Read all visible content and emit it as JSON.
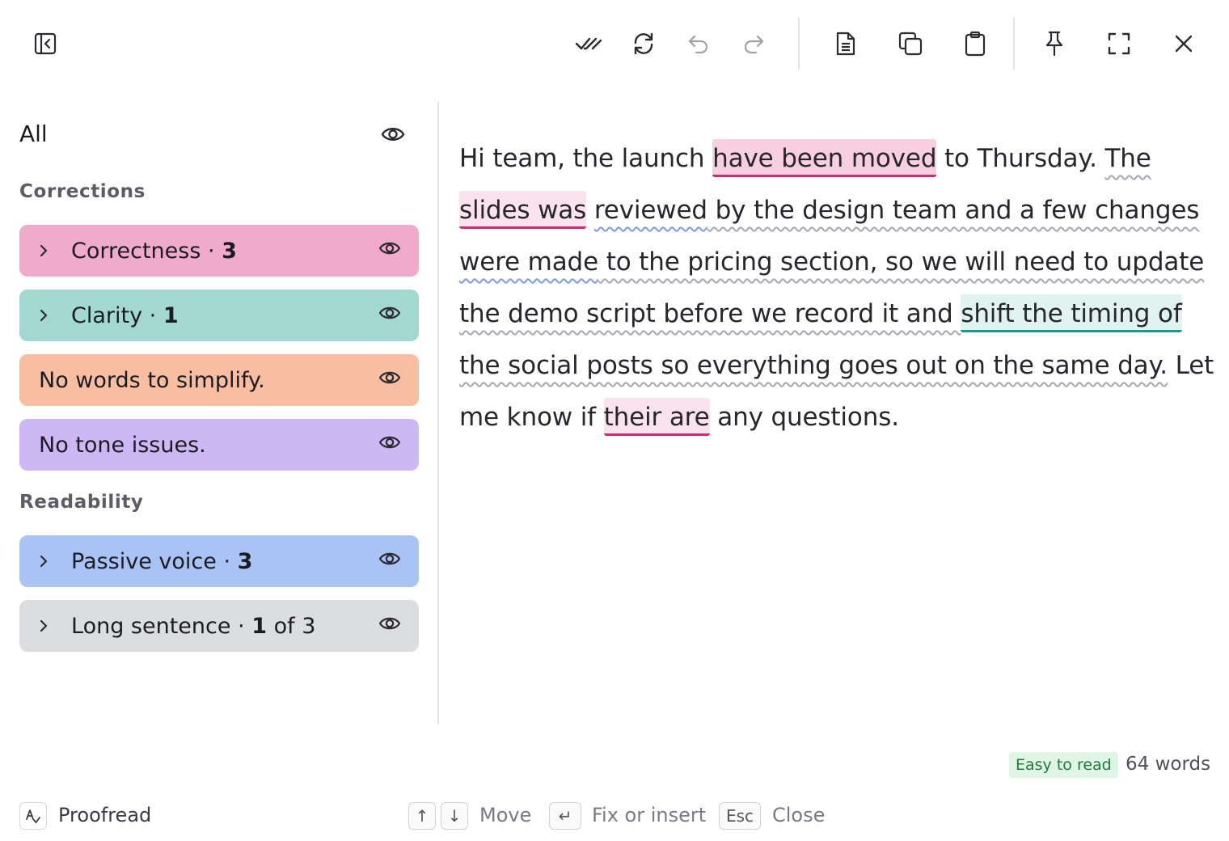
{
  "toolbar": {
    "sidebar_toggle_icon": "sidebar-collapse-icon",
    "actions": [
      "check-all-icon",
      "refresh-icon",
      "undo-icon",
      "redo-icon",
      "document-icon",
      "copy-icon",
      "clipboard-icon",
      "pin-icon",
      "fullscreen-icon",
      "close-icon"
    ]
  },
  "sidebar": {
    "all_label": "All",
    "corrections_title": "Corrections",
    "readability_title": "Readability",
    "cards": {
      "correctness": {
        "name": "Correctness · ",
        "count": "3",
        "color": "#f0aacb"
      },
      "clarity": {
        "name": "Clarity · ",
        "count": "1",
        "color": "#a3d7d2"
      },
      "simplify": {
        "text": "No words to simplify.",
        "color": "#f8bea2"
      },
      "tone": {
        "text": "No tone issues.",
        "color": "#cdb8f5"
      },
      "passive": {
        "name": "Passive voice · ",
        "count": "3",
        "color": "#aac3f5"
      },
      "long": {
        "name": "Long sentence · ",
        "count": "1",
        "suffix": " of 3",
        "color": "#dcdde1"
      }
    }
  },
  "document": {
    "l1": [
      "Hi team, the launch ",
      "have been moved",
      " to Thursday. ",
      "The"
    ],
    "l2": [
      "slides was",
      " ",
      "reviewed",
      " by the design team and a few changes"
    ],
    "l3": [
      "were made",
      " to the pricing section, so we will need to update"
    ],
    "l4": [
      "the demo script before we record it and ",
      "shift the timing of"
    ],
    "l5": [
      "the social posts so everything goes out on the same day.",
      " Let"
    ],
    "l6": [
      "me know if ",
      "their are",
      " any questions."
    ]
  },
  "status": {
    "readability_badge": "Easy to read",
    "word_count": "64 words"
  },
  "footer": {
    "proofread_label": "Proofread",
    "up_key": "↑",
    "down_key": "↓",
    "move_label": "Move",
    "enter_key": "↵",
    "fix_label": "Fix or insert",
    "esc_key": "Esc",
    "close_label": "Close"
  }
}
